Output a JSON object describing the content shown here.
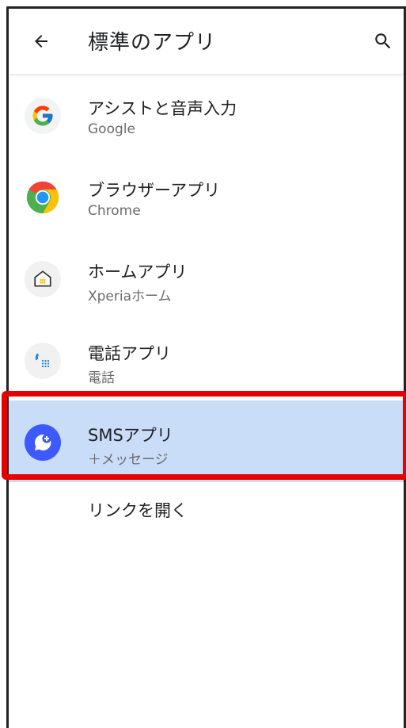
{
  "appbar": {
    "title": "標準のアプリ",
    "back_icon": "arrow-back-icon",
    "search_icon": "search-icon"
  },
  "items": [
    {
      "label": "アシストと音声入力",
      "sub": "Google",
      "icon": "google-icon"
    },
    {
      "label": "ブラウザーアプリ",
      "sub": "Chrome",
      "icon": "chrome-icon"
    },
    {
      "label": "ホームアプリ",
      "sub": "Xperiaホーム",
      "icon": "home-icon"
    },
    {
      "label": "電話アプリ",
      "sub": "電話",
      "icon": "phone-icon"
    },
    {
      "label": "SMSアプリ",
      "sub": "＋メッセージ",
      "icon": "plus-message-icon"
    },
    {
      "label": "リンクを開く"
    }
  ],
  "colors": {
    "highlight_bg": "#c9dcf8",
    "highlight_border": "#e60000"
  }
}
